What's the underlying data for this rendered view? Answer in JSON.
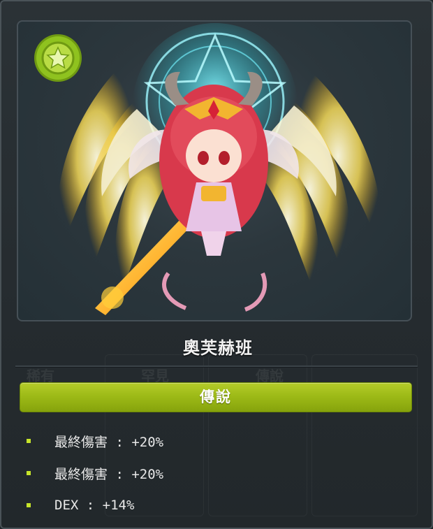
{
  "item": {
    "name": "奧芙赫班",
    "rarity_label": "傳說",
    "badge_icon": "star-icon",
    "colors": {
      "rarity_green": "#9dba17",
      "bullet": "#c6e42a",
      "badge_green": "#8fc21f"
    }
  },
  "background_tabs": [
    "稀有",
    "罕見",
    "傳說"
  ],
  "stats": [
    {
      "text": "最終傷害 : +20%"
    },
    {
      "text": "最終傷害 : +20%"
    },
    {
      "text": "DEX : +14%"
    }
  ]
}
